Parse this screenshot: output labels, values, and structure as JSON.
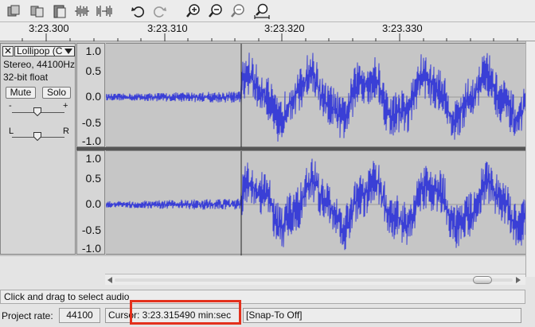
{
  "toolbar": {
    "buttons": [
      {
        "name": "cut-icon"
      },
      {
        "name": "copy-icon"
      },
      {
        "name": "paste-icon"
      },
      {
        "name": "trim-icon"
      },
      {
        "name": "silence-icon"
      },
      {
        "name": "undo-icon"
      },
      {
        "name": "redo-icon"
      },
      {
        "name": "zoom-in-icon"
      },
      {
        "name": "zoom-out-icon"
      },
      {
        "name": "fit-selection-icon"
      },
      {
        "name": "fit-project-icon"
      }
    ]
  },
  "ruler": {
    "labels": [
      "3:23.300",
      "3:23.310",
      "3:23.320",
      "3:23.330"
    ]
  },
  "track": {
    "name": "Lollipop (C",
    "format": "Stereo, 44100Hz",
    "bit_depth": "32-bit float",
    "mute_label": "Mute",
    "solo_label": "Solo",
    "gain_minus": "-",
    "gain_plus": "+",
    "pan_left": "L",
    "pan_right": "R",
    "close_glyph": "✕"
  },
  "amplitude_labels": [
    "1.0",
    "0.5",
    "0.0",
    "-0.5",
    "-1.0"
  ],
  "status": {
    "message": "Click and drag to select audio",
    "project_rate_label": "Project rate:",
    "project_rate_value": "44100",
    "cursor": "Cursor: 3:23.315490 min:sec",
    "snap": "[Snap-To Off]"
  },
  "colors": {
    "waveform": "#3a3fd6",
    "highlight": "#e3301c"
  }
}
